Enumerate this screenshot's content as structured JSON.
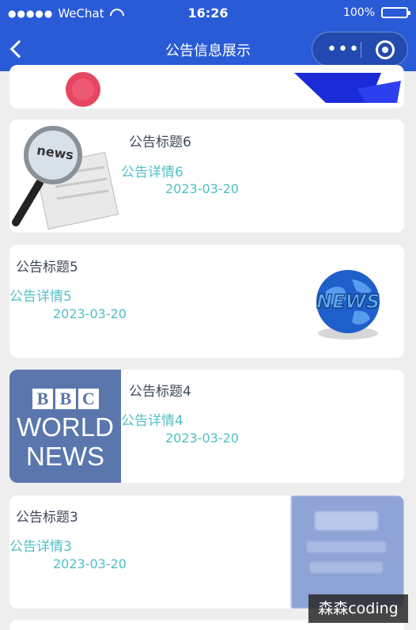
{
  "status_bar": {
    "carrier": "WeChat",
    "time": "16:26",
    "battery": "100%"
  },
  "nav": {
    "title": "公告信息展示"
  },
  "items": [
    {
      "title": "公告标题6",
      "detail": "公告详情6",
      "date": "2023-03-20",
      "image": "news-magnifier"
    },
    {
      "title": "公告标题5",
      "detail": "公告详情5",
      "date": "2023-03-20",
      "image": "news-globe"
    },
    {
      "title": "公告标题4",
      "detail": "公告详情4",
      "date": "2023-03-20",
      "image": "bbc-world-news",
      "logo_text": [
        "B",
        "B",
        "C",
        "WORLD",
        "NEWS"
      ]
    },
    {
      "title": "公告标题3",
      "detail": "公告详情3",
      "date": "2023-03-20",
      "image": "blurred-thumbnail"
    }
  ],
  "watermark": "森森coding",
  "colors": {
    "nav_bg": "#2a5bd7",
    "detail_text": "#52c1c7",
    "title_text": "#3e4a5c",
    "page_bg": "#eeeeee"
  }
}
